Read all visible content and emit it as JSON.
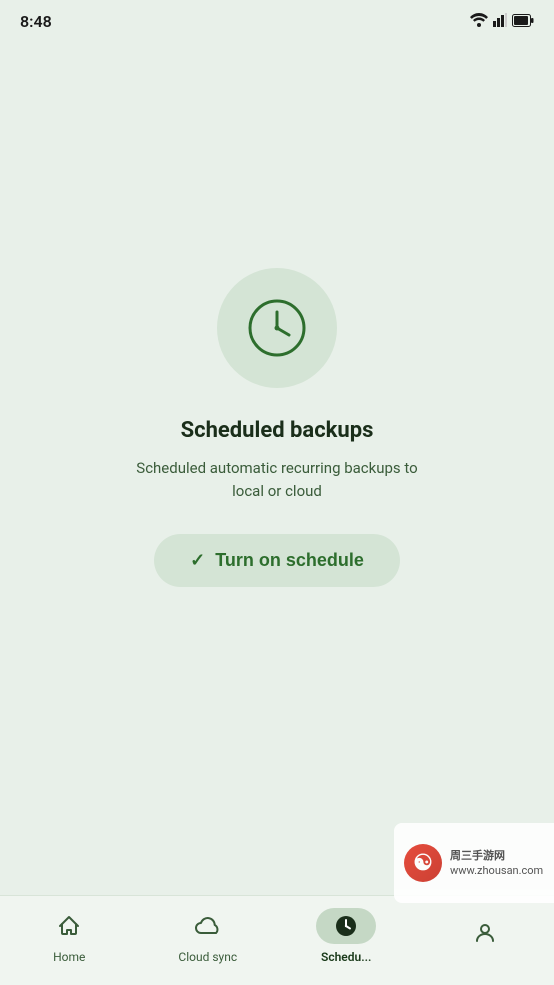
{
  "statusBar": {
    "time": "8:48"
  },
  "main": {
    "title": "Scheduled backups",
    "subtitle": "Scheduled automatic recurring backups to local or cloud",
    "buttonLabel": "Turn on schedule"
  },
  "bottomNav": {
    "items": [
      {
        "id": "home",
        "label": "Home",
        "active": false
      },
      {
        "id": "cloud-sync",
        "label": "Cloud sync",
        "active": false
      },
      {
        "id": "schedule",
        "label": "Schedu...",
        "active": true
      },
      {
        "id": "profile",
        "label": "",
        "active": false
      }
    ]
  }
}
